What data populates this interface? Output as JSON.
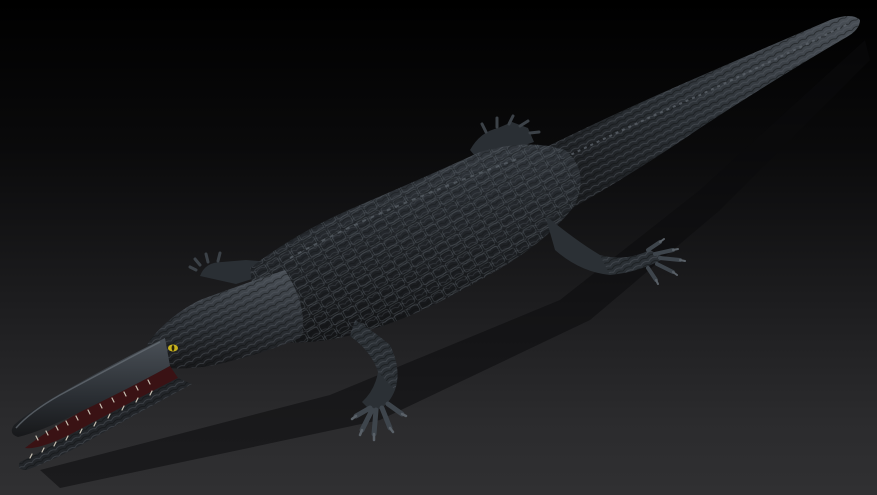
{
  "scene": {
    "subject_icon": "crocodilian-3d-model-icon",
    "colors": {
      "background_top": "#000000",
      "background_bottom": "#303032",
      "body_dark": "#16181b",
      "body_mid": "#2b3036",
      "body_light": "#464c53",
      "belly": "#3a3e42",
      "mouth": "#3a1214",
      "teeth": "#c9c2b4",
      "eye": "#c8b21e"
    }
  }
}
